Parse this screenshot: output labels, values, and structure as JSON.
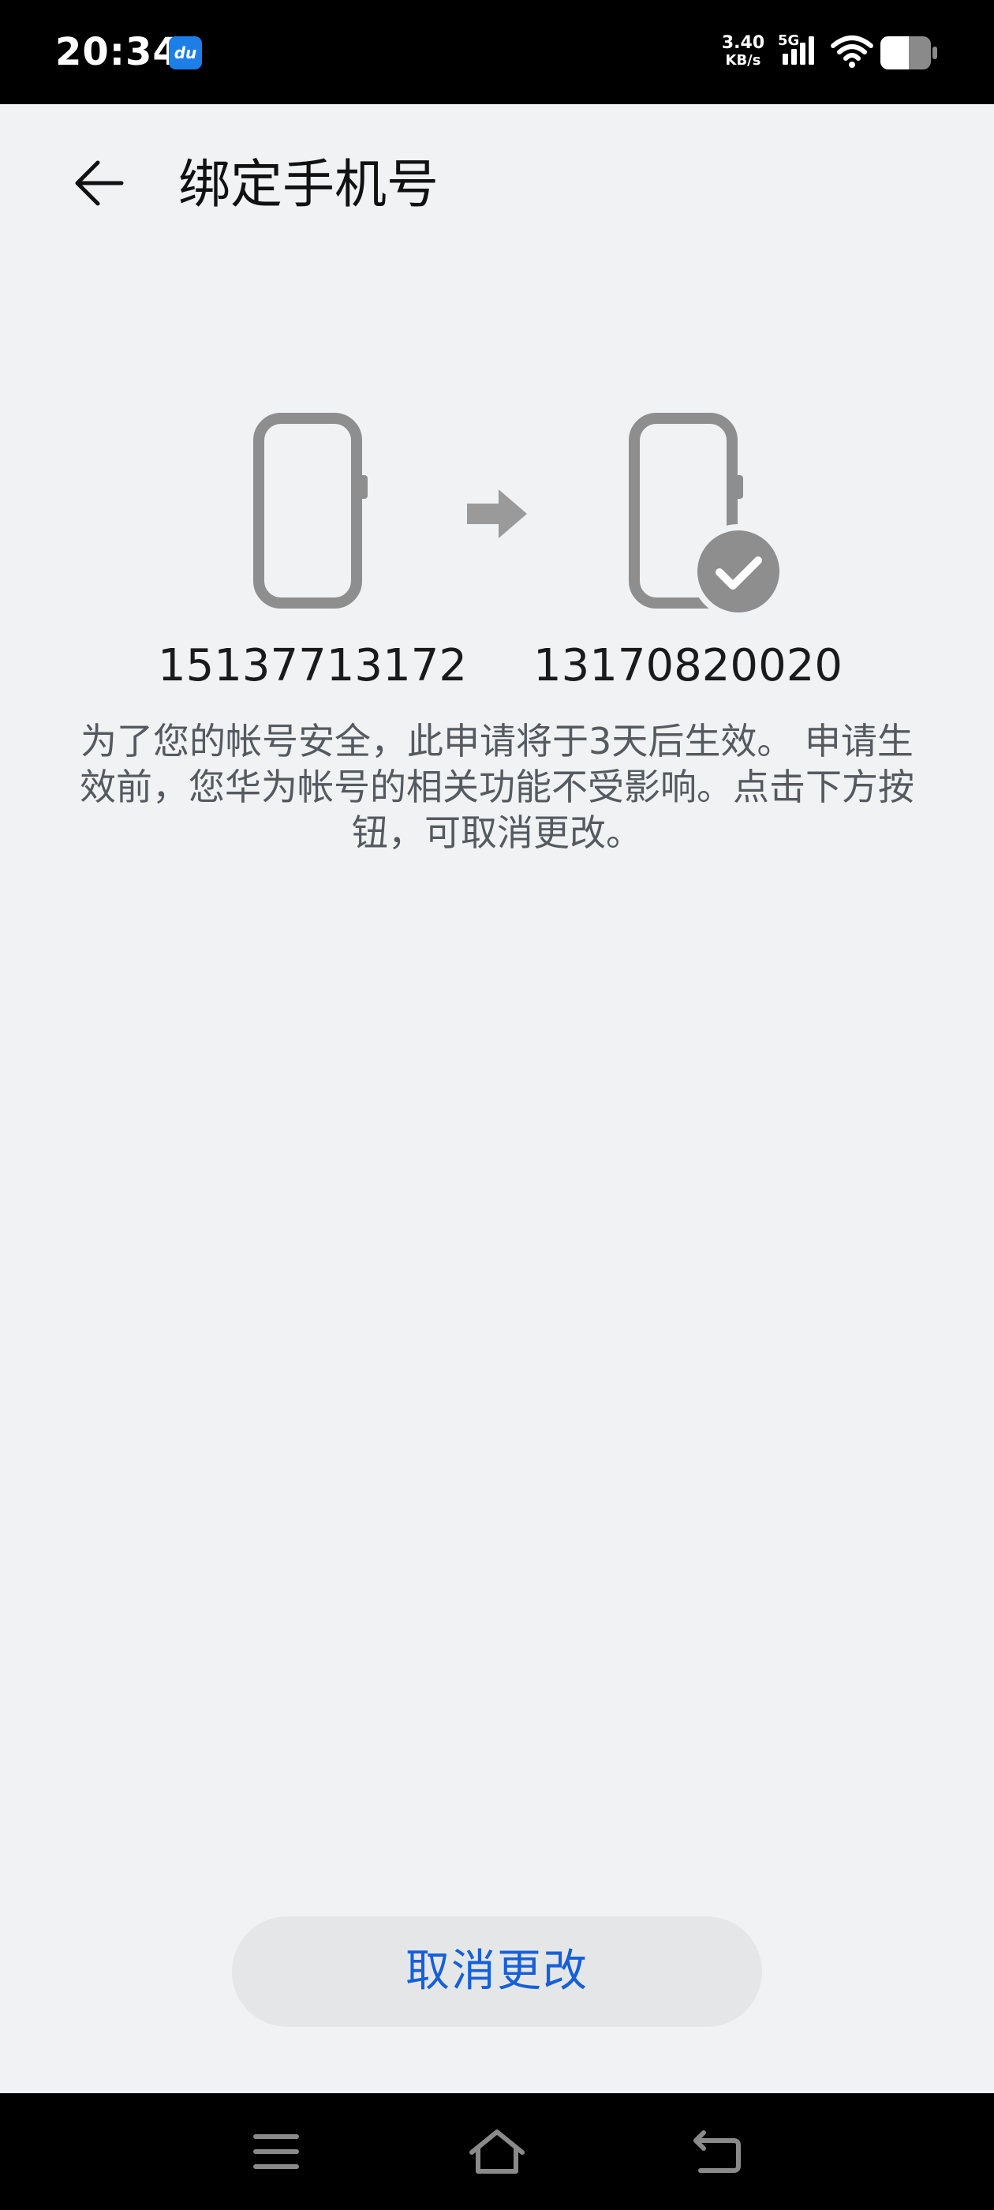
{
  "status_bar": {
    "time": "20:34",
    "app_icon_text": "du",
    "net_speed_value": "3.40",
    "net_speed_unit": "KB/s",
    "network_type": "5G",
    "icons": [
      "signal-icon",
      "wifi-icon",
      "battery-icon"
    ]
  },
  "header": {
    "back_icon": "back-arrow-icon",
    "title": "绑定手机号"
  },
  "binding": {
    "old_number": "15137713172",
    "new_number": "13170820020",
    "illustration_icons": [
      "phone-icon",
      "arrow-right-icon",
      "phone-check-icon"
    ],
    "notice": "为了您的帐号安全，此申请将于3天后生效。 申请生效前，您华为帐号的相关功能不受影响。点击下方按钮，可取消更改。"
  },
  "actions": {
    "cancel_label": "取消更改"
  },
  "nav_bar": {
    "icons": [
      "menu-icon",
      "home-icon",
      "back-icon"
    ]
  },
  "colors": {
    "background": "#f1f2f4",
    "accent": "#1560d8",
    "icon_gray": "#8e8e8e",
    "button_bg": "#e5e6e8"
  }
}
